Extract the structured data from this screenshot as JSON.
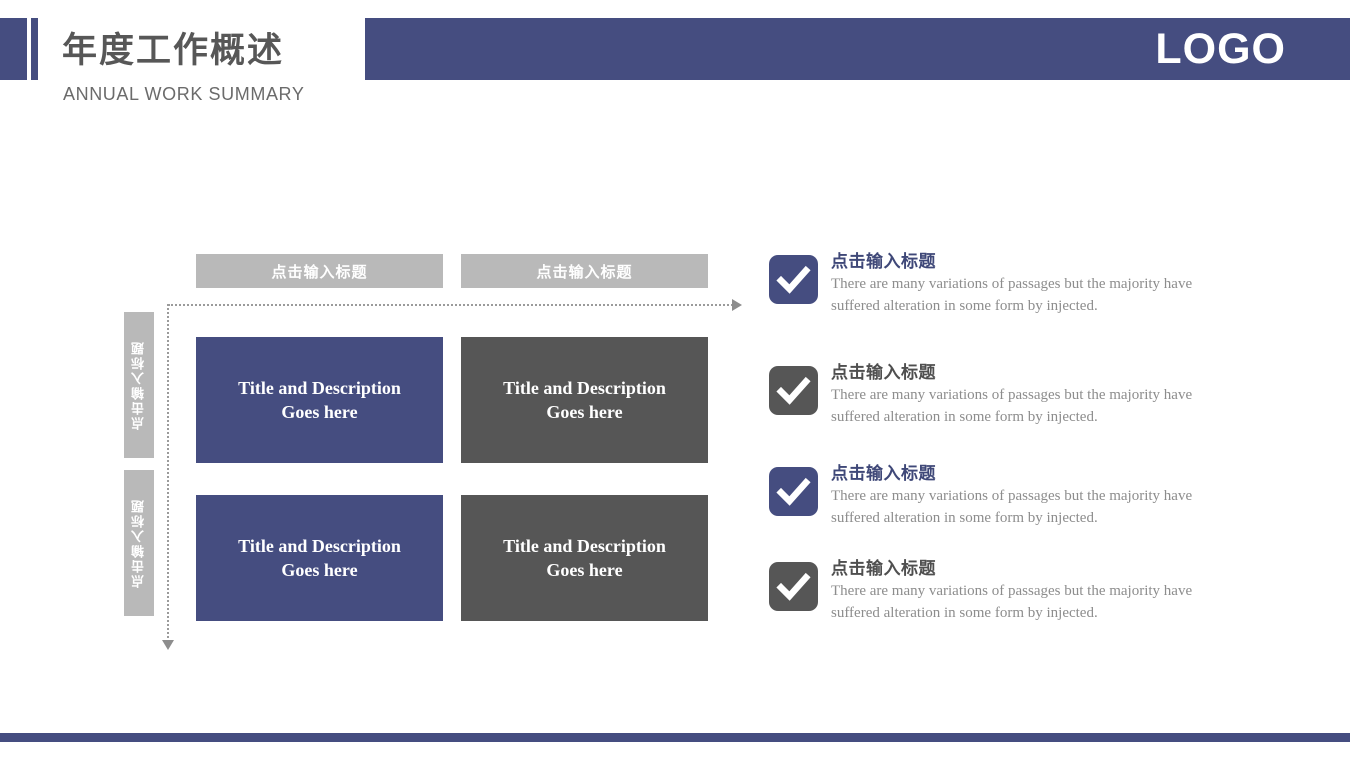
{
  "header": {
    "title_cn": "年度工作概述",
    "title_en": "ANNUAL WORK SUMMARY",
    "logo": "LOGO",
    "accent_color": "#454d80",
    "gray_color": "#565656",
    "header_gray": "#b9b9b9"
  },
  "matrix": {
    "column_headers": [
      {
        "label": "点击输入标题"
      },
      {
        "label": "点击输入标题"
      }
    ],
    "row_headers": [
      {
        "label": "点击输入标题"
      },
      {
        "label": "点击输入标题"
      }
    ],
    "cells": [
      {
        "line1": "Title and Description",
        "line2": "Goes here",
        "style": "blue"
      },
      {
        "line1": "Title and Description",
        "line2": "Goes here",
        "style": "gray"
      },
      {
        "line1": "Title and Description",
        "line2": "Goes here",
        "style": "blue"
      },
      {
        "line1": "Title and Description",
        "line2": "Goes here",
        "style": "gray"
      }
    ]
  },
  "bullets": [
    {
      "icon": "check-icon",
      "style": "blue",
      "title": "点击输入标题",
      "desc": "There are many variations of passages but the majority have  suffered alteration in some form by injected."
    },
    {
      "icon": "check-icon",
      "style": "gray",
      "title": "点击输入标题",
      "desc": "There are many variations of passages but the majority have  suffered alteration in some form by injected."
    },
    {
      "icon": "check-icon",
      "style": "blue",
      "title": "点击输入标题",
      "desc": "There are many variations of passages but the majority have  suffered alteration in some form by injected."
    },
    {
      "icon": "check-icon",
      "style": "gray",
      "title": "点击输入标题",
      "desc": "There are many variations of passages but the majority have  suffered alteration in some form by injected."
    }
  ]
}
